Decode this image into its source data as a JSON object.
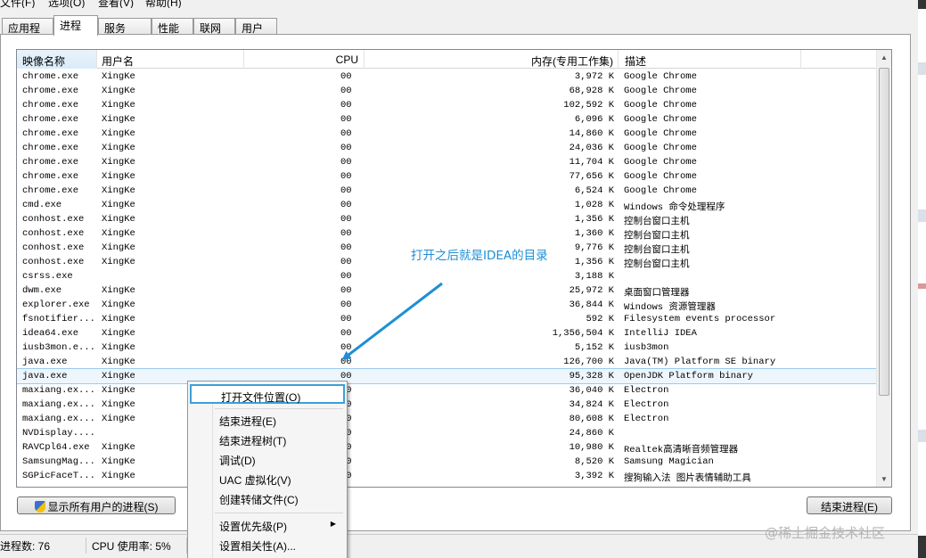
{
  "menu": {
    "items": [
      "文件(F)",
      "选项(O)",
      "查看(V)",
      "帮助(H)"
    ]
  },
  "tabs": [
    "应用程序",
    "进程",
    "服务",
    "性能",
    "联网",
    "用户"
  ],
  "active_tab": "进程",
  "columns": {
    "name": "映像名称",
    "user": "用户名",
    "cpu": "CPU",
    "mem": "内存(专用工作集)",
    "desc": "描述"
  },
  "processes": [
    {
      "name": "chrome.exe",
      "user": "XingKe",
      "cpu": "00",
      "mem": "3,972 K",
      "desc": "Google Chrome"
    },
    {
      "name": "chrome.exe",
      "user": "XingKe",
      "cpu": "00",
      "mem": "68,928 K",
      "desc": "Google Chrome"
    },
    {
      "name": "chrome.exe",
      "user": "XingKe",
      "cpu": "00",
      "mem": "102,592 K",
      "desc": "Google Chrome"
    },
    {
      "name": "chrome.exe",
      "user": "XingKe",
      "cpu": "00",
      "mem": "6,096 K",
      "desc": "Google Chrome"
    },
    {
      "name": "chrome.exe",
      "user": "XingKe",
      "cpu": "00",
      "mem": "14,860 K",
      "desc": "Google Chrome"
    },
    {
      "name": "chrome.exe",
      "user": "XingKe",
      "cpu": "00",
      "mem": "24,036 K",
      "desc": "Google Chrome"
    },
    {
      "name": "chrome.exe",
      "user": "XingKe",
      "cpu": "00",
      "mem": "11,704 K",
      "desc": "Google Chrome"
    },
    {
      "name": "chrome.exe",
      "user": "XingKe",
      "cpu": "00",
      "mem": "77,656 K",
      "desc": "Google Chrome"
    },
    {
      "name": "chrome.exe",
      "user": "XingKe",
      "cpu": "00",
      "mem": "6,524 K",
      "desc": "Google Chrome"
    },
    {
      "name": "cmd.exe",
      "user": "XingKe",
      "cpu": "00",
      "mem": "1,028 K",
      "desc": "Windows 命令处理程序"
    },
    {
      "name": "conhost.exe",
      "user": "XingKe",
      "cpu": "00",
      "mem": "1,356 K",
      "desc": "控制台窗口主机"
    },
    {
      "name": "conhost.exe",
      "user": "XingKe",
      "cpu": "00",
      "mem": "1,360 K",
      "desc": "控制台窗口主机"
    },
    {
      "name": "conhost.exe",
      "user": "XingKe",
      "cpu": "00",
      "mem": "9,776 K",
      "desc": "控制台窗口主机"
    },
    {
      "name": "conhost.exe",
      "user": "XingKe",
      "cpu": "00",
      "mem": "1,356 K",
      "desc": "控制台窗口主机"
    },
    {
      "name": "csrss.exe",
      "user": "",
      "cpu": "00",
      "mem": "3,188 K",
      "desc": ""
    },
    {
      "name": "dwm.exe",
      "user": "XingKe",
      "cpu": "00",
      "mem": "25,972 K",
      "desc": "桌面窗口管理器"
    },
    {
      "name": "explorer.exe",
      "user": "XingKe",
      "cpu": "00",
      "mem": "36,844 K",
      "desc": "Windows 资源管理器"
    },
    {
      "name": "fsnotifier...",
      "user": "XingKe",
      "cpu": "00",
      "mem": "592 K",
      "desc": "Filesystem events processor"
    },
    {
      "name": "idea64.exe",
      "user": "XingKe",
      "cpu": "00",
      "mem": "1,356,504 K",
      "desc": "IntelliJ IDEA"
    },
    {
      "name": "iusb3mon.e...",
      "user": "XingKe",
      "cpu": "00",
      "mem": "5,152 K",
      "desc": "iusb3mon"
    },
    {
      "name": "java.exe",
      "user": "XingKe",
      "cpu": "00",
      "mem": "126,700 K",
      "desc": "Java(TM) Platform SE binary"
    },
    {
      "name": "java.exe",
      "user": "XingKe",
      "cpu": "00",
      "mem": "95,328 K",
      "desc": "OpenJDK Platform binary"
    },
    {
      "name": "maxiang.ex...",
      "user": "XingKe",
      "cpu": "00",
      "mem": "36,040 K",
      "desc": "Electron"
    },
    {
      "name": "maxiang.ex...",
      "user": "XingKe",
      "cpu": "00",
      "mem": "34,824 K",
      "desc": "Electron"
    },
    {
      "name": "maxiang.ex...",
      "user": "XingKe",
      "cpu": "00",
      "mem": "80,608 K",
      "desc": "Electron"
    },
    {
      "name": "NVDisplay....",
      "user": "",
      "cpu": "00",
      "mem": "24,860 K",
      "desc": ""
    },
    {
      "name": "RAVCpl64.exe",
      "user": "XingKe",
      "cpu": "00",
      "mem": "10,980 K",
      "desc": "Realtek高清晰音频管理器"
    },
    {
      "name": "SamsungMag...",
      "user": "XingKe",
      "cpu": "00",
      "mem": "8,520 K",
      "desc": "Samsung Magician"
    },
    {
      "name": "SGPicFaceT...",
      "user": "XingKe",
      "cpu": "00",
      "mem": "3,392 K",
      "desc": "搜狗输入法 图片表情辅助工具"
    }
  ],
  "selected_row": 21,
  "buttons": {
    "show_all": "显示所有用户的进程(S)",
    "end_process": "结束进程(E)"
  },
  "status": {
    "processes": "进程数: 76",
    "cpu": "CPU 使用率: 5%"
  },
  "context_menu": {
    "items": [
      "打开文件位置(O)",
      "结束进程(E)",
      "结束进程树(T)",
      "调试(D)",
      "UAC 虚拟化(V)",
      "创建转储文件(C)",
      "设置优先级(P)",
      "设置相关性(A)..."
    ]
  },
  "annotation": "打开之后就是IDEA的目录",
  "watermark": "@稀土掘金技术社区",
  "colors": {
    "annotation": "#1e8fd6",
    "selection_outline": "#99cbf3",
    "menu_highlight": "#3aa0d8"
  }
}
